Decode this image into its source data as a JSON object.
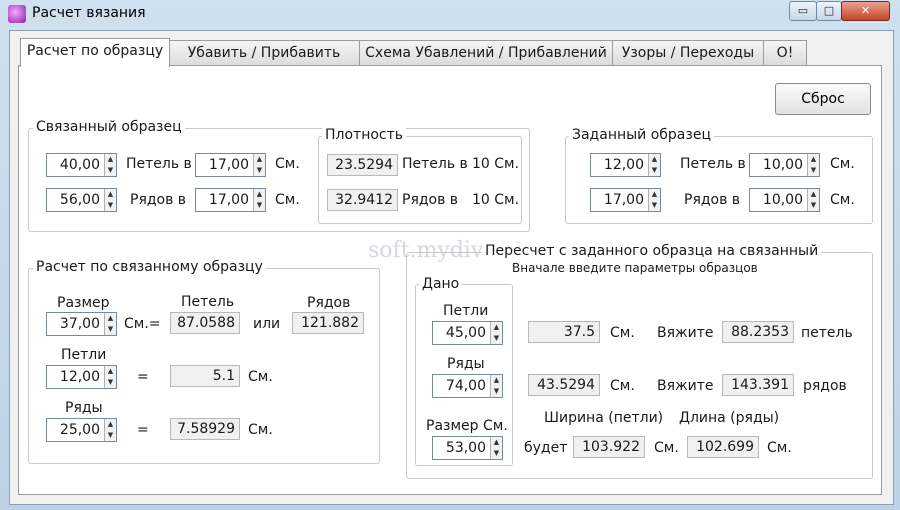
{
  "window": {
    "title": "Расчет вязания",
    "buttons": [
      "▭",
      "□",
      "✕"
    ]
  },
  "tabs": [
    "Расчет по образцу",
    "Убавить / Прибавить",
    "Схема Убавлений / Прибавлений",
    "Узоры / Переходы",
    "О!"
  ],
  "reset_label": "Сброс",
  "watermark": "soft.mydiv.net",
  "knitted": {
    "title": "Связанный образец",
    "stitches": "40,00",
    "stitches_label": "Петель в",
    "stitches_cm": "17,00",
    "cm": "См.",
    "rows": "56,00",
    "rows_label": "Рядов в",
    "rows_cm": "17,00"
  },
  "density": {
    "title": "Плотность",
    "stitch_val": "23.5294",
    "stitch_label": "Петель в",
    "per1": "10 См.",
    "row_val": "32.9412",
    "row_label": "Рядов в",
    "per2": "10 См."
  },
  "target": {
    "title": "Заданный образец",
    "stitches": "12,00",
    "stitches_label": "Петель в",
    "stitches_cm": "10,00",
    "cm": "См.",
    "rows": "17,00",
    "rows_label": "Рядов в",
    "rows_cm": "10,00"
  },
  "calc": {
    "title": "Расчет по связанному образцу",
    "size_label": "Размер",
    "stitches_hdr": "Петель",
    "rows_hdr": "Рядов",
    "size": "37,00",
    "cm_eq": "См.=",
    "size_stitches": "87.0588",
    "or": "или",
    "size_rows": "121.882",
    "loops_label": "Петли",
    "loops": "12,00",
    "eq1": "=",
    "loops_result": "5.1",
    "cm1": "См.",
    "rows_label": "Ряды",
    "rows": "25,00",
    "eq2": "=",
    "rows_result": "7.58929",
    "cm2": "См."
  },
  "recalc": {
    "title": "Пересчет с заданного образца на связанный",
    "hint": "Вначале введите параметры образцов",
    "given_title": "Дано",
    "loops_label": "Петли",
    "loops": "45,00",
    "loops_cm": "37.5",
    "cm1": "См.",
    "knit1": "Вяжите",
    "loops_out": "88.2353",
    "loops_unit": "петель",
    "rows_label": "Ряды",
    "rows": "74,00",
    "rows_cm": "43.5294",
    "cm2": "См.",
    "knit2": "Вяжите",
    "rows_out": "143.391",
    "rows_unit": "рядов",
    "size_label": "Размер См.",
    "size": "53,00",
    "width_label": "Ширина (петли)",
    "length_label": "Длина (ряды)",
    "will_be": "будет",
    "width_val": "103.922",
    "cm3": "См.",
    "length_val": "102.699",
    "cm4": "См."
  }
}
